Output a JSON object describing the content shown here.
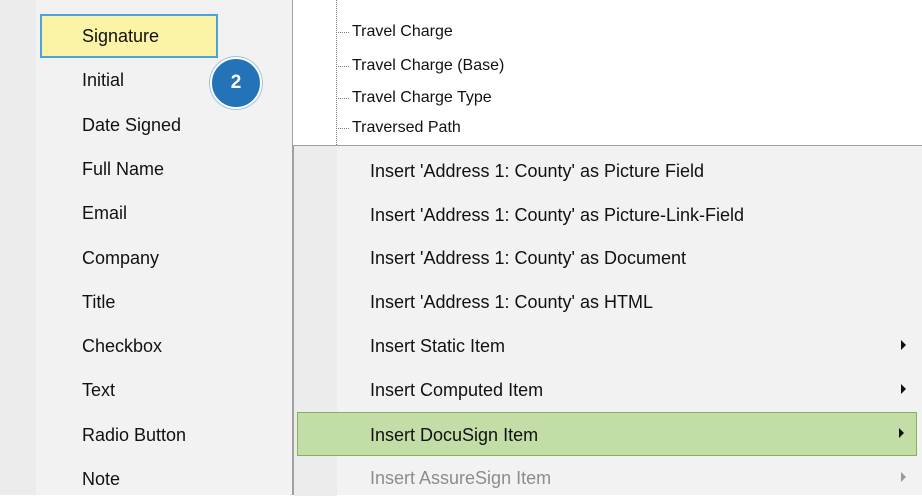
{
  "submenu": {
    "items": [
      {
        "label": "Signature",
        "highlighted": true
      },
      {
        "label": "Initial"
      },
      {
        "label": "Date Signed"
      },
      {
        "label": "Full Name"
      },
      {
        "label": "Email"
      },
      {
        "label": "Company"
      },
      {
        "label": "Title"
      },
      {
        "label": "Checkbox"
      },
      {
        "label": "Text"
      },
      {
        "label": "Radio Button"
      },
      {
        "label": "Note"
      }
    ]
  },
  "badge": {
    "number": "2",
    "color": "#2473b8"
  },
  "tree": {
    "items": [
      {
        "label": "Travel Charge"
      },
      {
        "label": "Travel Charge (Base)"
      },
      {
        "label": "Travel Charge Type"
      },
      {
        "label": "Traversed Path"
      }
    ]
  },
  "context_menu": {
    "items": [
      {
        "label": "Insert 'Address 1: County' as Picture Field",
        "has_submenu": false
      },
      {
        "label": "Insert 'Address 1: County' as Picture-Link-Field",
        "has_submenu": false
      },
      {
        "label": "Insert 'Address 1: County' as Document",
        "has_submenu": false
      },
      {
        "label": "Insert 'Address 1: County' as HTML",
        "has_submenu": false
      },
      {
        "label": "Insert Static Item",
        "has_submenu": true
      },
      {
        "label": "Insert Computed Item",
        "has_submenu": true
      },
      {
        "label": "Insert DocuSign Item",
        "has_submenu": true,
        "highlighted": true
      },
      {
        "label": "Insert AssureSign Item",
        "has_submenu": true,
        "disabled": true
      }
    ]
  },
  "colors": {
    "menu_background": "#f2f2f2",
    "highlight_green": "#c3dda7",
    "highlight_yellow": "#fbf4a7",
    "focus_border_blue": "#4aa3df",
    "disabled_text": "#8c8c8c"
  }
}
